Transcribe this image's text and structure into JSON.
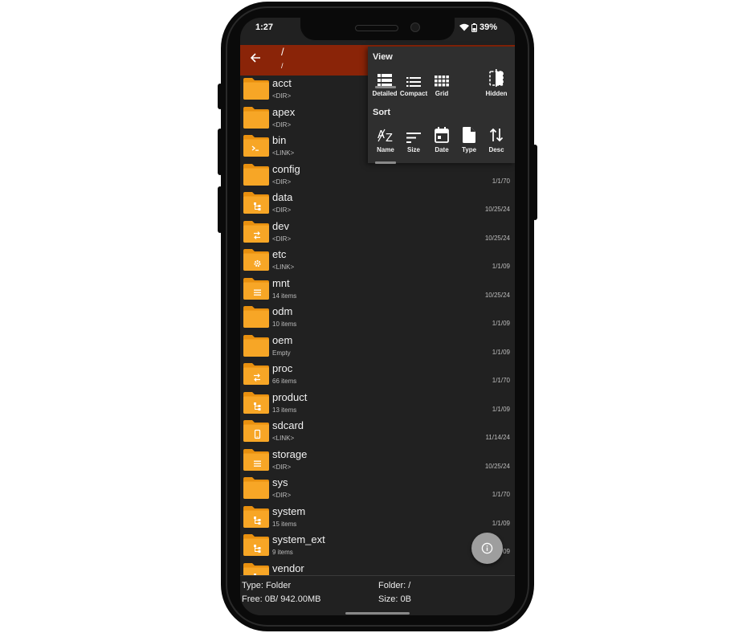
{
  "status": {
    "time": "1:27",
    "battery": "39%"
  },
  "header": {
    "path": "/",
    "subpath": "/"
  },
  "files": [
    {
      "name": "acct",
      "sub": "<DIR>",
      "date": "",
      "emblem": ""
    },
    {
      "name": "apex",
      "sub": "<DIR>",
      "date": "",
      "emblem": ""
    },
    {
      "name": "bin",
      "sub": "<LINK>",
      "date": "",
      "emblem": "terminal"
    },
    {
      "name": "config",
      "sub": "<DIR>",
      "date": "1/1/70",
      "emblem": ""
    },
    {
      "name": "data",
      "sub": "<DIR>",
      "date": "10/25/24",
      "emblem": "tree"
    },
    {
      "name": "dev",
      "sub": "<DIR>",
      "date": "10/25/24",
      "emblem": "arrows"
    },
    {
      "name": "etc",
      "sub": "<LINK>",
      "date": "1/1/09",
      "emblem": "gear"
    },
    {
      "name": "mnt",
      "sub": "14 items",
      "date": "10/25/24",
      "emblem": "list"
    },
    {
      "name": "odm",
      "sub": "10 items",
      "date": "1/1/09",
      "emblem": ""
    },
    {
      "name": "oem",
      "sub": "Empty",
      "date": "1/1/09",
      "emblem": ""
    },
    {
      "name": "proc",
      "sub": "66 items",
      "date": "1/1/70",
      "emblem": "arrows"
    },
    {
      "name": "product",
      "sub": "13 items",
      "date": "1/1/09",
      "emblem": "tree"
    },
    {
      "name": "sdcard",
      "sub": "<LINK>",
      "date": "11/14/24",
      "emblem": "phone"
    },
    {
      "name": "storage",
      "sub": "<DIR>",
      "date": "10/25/24",
      "emblem": "list"
    },
    {
      "name": "sys",
      "sub": "<DIR>",
      "date": "1/1/70",
      "emblem": ""
    },
    {
      "name": "system",
      "sub": "15 items",
      "date": "1/1/09",
      "emblem": "tree"
    },
    {
      "name": "system_ext",
      "sub": "9 items",
      "date": "1/1/09",
      "emblem": "tree"
    },
    {
      "name": "vendor",
      "sub": "",
      "date": "",
      "emblem": "tree"
    }
  ],
  "popup": {
    "view_title": "View",
    "sort_title": "Sort",
    "view_options": [
      {
        "label": "Detailed",
        "icon": "detailed-view-icon",
        "selected": true
      },
      {
        "label": "Compact",
        "icon": "compact-view-icon",
        "selected": false
      },
      {
        "label": "Grid",
        "icon": "grid-view-icon",
        "selected": false
      },
      {
        "label": "Hidden",
        "icon": "hidden-files-icon",
        "selected": false
      }
    ],
    "sort_options": [
      {
        "label": "Name",
        "icon": "sort-az-icon",
        "selected": true
      },
      {
        "label": "Size",
        "icon": "sort-size-icon",
        "selected": false
      },
      {
        "label": "Date",
        "icon": "calendar-icon",
        "selected": false
      },
      {
        "label": "Type",
        "icon": "file-type-icon",
        "selected": false
      },
      {
        "label": "Desc",
        "icon": "sort-direction-icon",
        "selected": false
      }
    ]
  },
  "footer": {
    "type": "Type: Folder",
    "free": "Free: 0B/ 942.00MB",
    "folder": "Folder: /",
    "size": "Size: 0B"
  },
  "colors": {
    "accent": "#8a2408",
    "folder": "#f4a21c",
    "background": "#212121"
  }
}
